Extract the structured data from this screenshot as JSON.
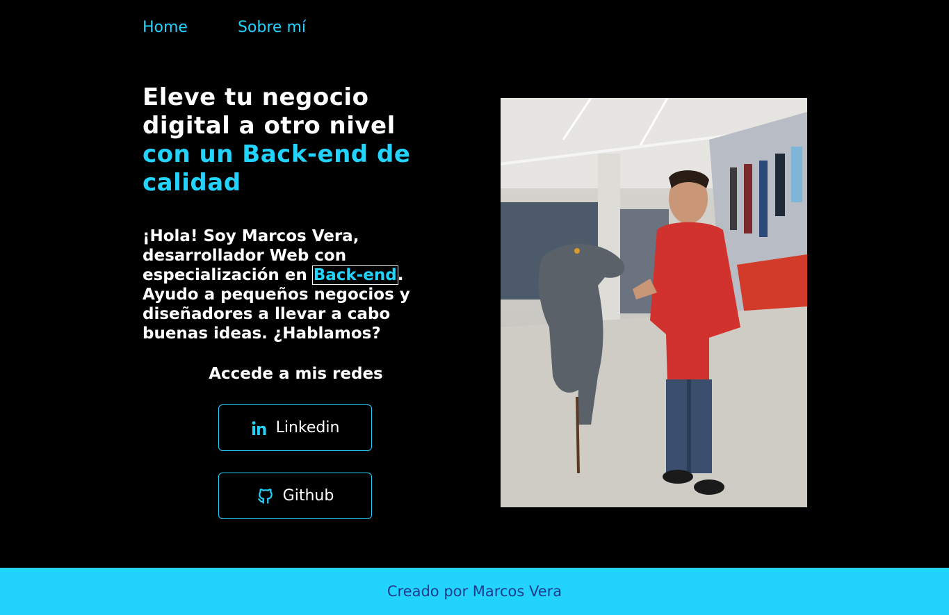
{
  "nav": {
    "items": [
      {
        "label": "Home"
      },
      {
        "label": "Sobre mí"
      }
    ]
  },
  "hero": {
    "headline_line1": "Eleve tu negocio",
    "headline_line2": "digital a otro nivel",
    "headline_accent": "con un Back-end de calidad",
    "intro_before": "¡Hola! Soy Marcos Vera, desarrollador Web con especialización en ",
    "intro_highlight": "Back-end",
    "intro_after": ". Ayudo a pequeños negocios y diseñadores a llevar a cabo buenas ideas. ¿Hablamos?"
  },
  "socials": {
    "title": "Accede a mis redes",
    "linkedin_label": "Linkedin",
    "github_label": "Github"
  },
  "photo": {
    "icon": "profile-photo"
  },
  "footer": {
    "text": "Creado por Marcos Vera"
  },
  "colors": {
    "background": "#000000",
    "accent": "#22d3fe",
    "text": "#ffffff",
    "footer_text": "#1e3a8a"
  }
}
